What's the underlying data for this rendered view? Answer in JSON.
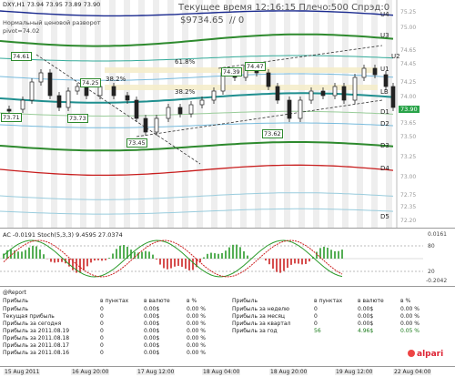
{
  "main": {
    "symbol_header": "DXY,H1  73.94 73.95 73.89 73.90",
    "indicator1": "Нормальный ценовой разворот",
    "indicator2": "pivot=74.02",
    "server_time": "Текущее время 12:16:15 Плечо:500 Спрэд:0",
    "balance": "$9734.65",
    "slash": "// 0",
    "fib_pct": [
      "61.8%",
      "38.2%",
      "38.2%"
    ],
    "box_labels": [
      "74.61",
      "73.71",
      "74.25",
      "73.73",
      "73.45",
      "74.39",
      "74.47",
      "73.62"
    ],
    "levels": [
      "U4",
      "U3",
      "U2",
      "U1",
      "LB",
      "D1",
      "D2",
      "D3",
      "D4",
      "D5"
    ],
    "prices": [
      "75.25",
      "75.00",
      "74.65",
      "74.45",
      "74.25",
      "74.00",
      "73.80",
      "73.65",
      "73.50",
      "73.25",
      "73.00",
      "72.75",
      "72.65",
      "72.35",
      "72.20"
    ],
    "current_price": "73.90"
  },
  "oscillator": {
    "header": "AC -0.0191  Stoch(5,3,3) 9.4595 27.0374",
    "scale": [
      "0.0161",
      "80",
      "20",
      "-0.2042"
    ]
  },
  "report": {
    "header": "@Report",
    "col_headers": {
      "profit": "Прибыль",
      "points": "в пунктах",
      "currency": "в валюте",
      "pct": "в %"
    },
    "left_rows": [
      {
        "label": "Прибыль",
        "points": "0",
        "currency": "0.00$",
        "pct": "0.00 %"
      },
      {
        "label": "Текущая прибыль",
        "points": "0",
        "currency": "0.00$",
        "pct": "0.00 %"
      },
      {
        "label": "Прибыль за сегодня",
        "points": "0",
        "currency": "0.00$",
        "pct": "0.00 %"
      },
      {
        "label": "Прибыль за 2011.08.19",
        "points": "0",
        "currency": "0.00$",
        "pct": "0.00 %"
      },
      {
        "label": "Прибыль за 2011.08.18",
        "points": "0",
        "currency": "0.00$",
        "pct": "0.00 %"
      },
      {
        "label": "Прибыль за 2011.08.17",
        "points": "0",
        "currency": "0.00$",
        "pct": "0.00 %"
      },
      {
        "label": "Прибыль за 2011.08.16",
        "points": "0",
        "currency": "0.00$",
        "pct": "0.00 %"
      }
    ],
    "right_rows": [
      {
        "label": "Прибыль",
        "points": "в пунктах",
        "currency": "в валюте",
        "pct": "в %"
      },
      {
        "label": "Прибыль за неделю",
        "points": "0",
        "currency": "0.00$",
        "pct": "0.00 %"
      },
      {
        "label": "Прибыль за месяц",
        "points": "0",
        "currency": "0.00$",
        "pct": "0.00 %"
      },
      {
        "label": "Прибыль за квартал",
        "points": "0",
        "currency": "0.00$",
        "pct": "0.00 %"
      },
      {
        "label": "Прибыль за год",
        "points": "56",
        "currency": "4.96$",
        "pct": "0.05 %"
      }
    ],
    "logo": "alpari"
  },
  "time_axis": [
    "15 Aug 2011",
    "16 Aug 20:00",
    "17 Aug 12:00",
    "18 Aug 04:00",
    "18 Aug 20:00",
    "19 Aug 12:00",
    "22 Aug 04:00"
  ],
  "colors": {
    "green": "#2e8a2e",
    "teal": "#1f8f8f",
    "navy": "#1a2a8f",
    "red": "#c81e1e",
    "candle": "#222222"
  }
}
